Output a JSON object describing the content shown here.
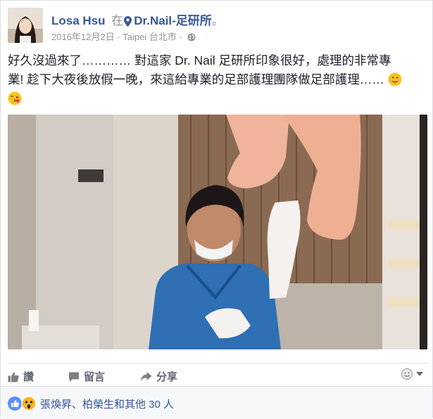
{
  "post": {
    "author": "Losa Hsu",
    "at": "在",
    "place": "Dr.Nail-足研所",
    "place_suffix": "。",
    "date": "2016年12月2日",
    "sep": "·",
    "location": "Taipei 台北市",
    "text_line1": "好久沒過來了………… 對這家 Dr. Nail 足研所印象很好，處理的非常專",
    "text_line2": "業! 趁下大夜後放假一晚，來這給專業的足部護理團隊做足部護理……"
  },
  "actions": {
    "like": "讚",
    "comment": "留言",
    "share": "分享"
  },
  "reactions": {
    "summary": "張煥昇、柏榮生和其他 30 人"
  },
  "icons": [
    "location-pin-icon",
    "globe-icon",
    "smile-emoji-icon",
    "kiss-emoji-icon",
    "thumbs-up-icon",
    "comment-icon",
    "share-icon",
    "audience-icon",
    "chevron-down-icon",
    "like-reaction-icon",
    "wow-reaction-icon"
  ],
  "colors": {
    "link": "#365899",
    "muted": "#90949c",
    "like": "#5890ff",
    "wow": "#f7b125"
  }
}
